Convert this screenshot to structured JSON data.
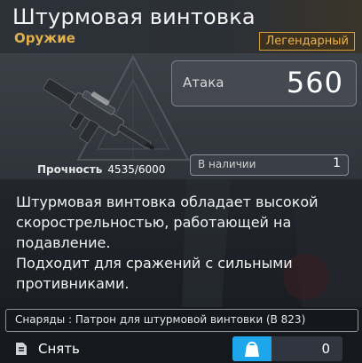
{
  "item": {
    "name": "Штурмовая винтовка",
    "category": "Оружие",
    "rarity": "Легендарный",
    "durability_label": "Прочность",
    "durability_value": "4535/6000"
  },
  "stats": {
    "attack_label": "Атака",
    "attack_value": "560",
    "stock_label": "В наличии",
    "stock_value": "1"
  },
  "description": {
    "line1": "Штурмовая винтовка обладает высокой",
    "line2": "скорострельностью, работающей на",
    "line3": "подавление.",
    "line4": "Подходит для сражений с сильными",
    "line5": "противниками."
  },
  "ammo": {
    "text": "Снаряды : Патрон для штурмовой винтовки (В 823)"
  },
  "actions": {
    "remove_label": "Снять",
    "count_value": "0"
  },
  "colors": {
    "rarity": "#f0b44a",
    "accent_blue": "#1ea6ea"
  },
  "icons": {
    "weapon": "assault-rifle-icon",
    "remove": "unequip-icon",
    "bag": "bag-icon"
  }
}
